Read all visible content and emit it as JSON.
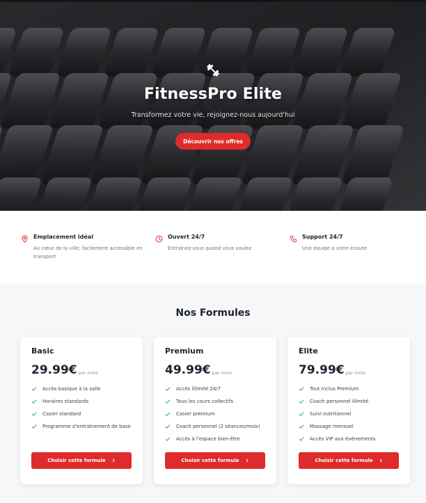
{
  "colors": {
    "accent": "#df2b2b",
    "check": "#3bb273",
    "bg": "#f6f7f9"
  },
  "hero": {
    "icon": "dumbbell-icon",
    "title": "FitnessPro Elite",
    "subtitle": "Transformez votre vie, rejoignez-nous aujourd'hui",
    "cta_label": "Découvrir nos offres"
  },
  "features": [
    {
      "icon": "location-pin-icon",
      "title": "Emplacement idéal",
      "desc": "Au cœur de la ville, facilement accessible en transport"
    },
    {
      "icon": "clock-icon",
      "title": "Ouvert 24/7",
      "desc": "Entraînez-vous quand vous voulez"
    },
    {
      "icon": "phone-icon",
      "title": "Support 24/7",
      "desc": "Une équipe à votre écoute"
    }
  ],
  "plans": {
    "title": "Nos Formules",
    "per_label": "par mois",
    "button_label": "Choisir cette formule",
    "items": [
      {
        "name": "Basic",
        "price": "29.99€",
        "features": [
          "Accès basique à la salle",
          "Horaires standards",
          "Casier standard",
          "Programme d'entraînement de base"
        ]
      },
      {
        "name": "Premium",
        "price": "49.99€",
        "features": [
          "Accès illimité 24/7",
          "Tous les cours collectifs",
          "Casier premium",
          "Coach personnel (2 séances/mois)",
          "Accès à l'espace bien-être"
        ]
      },
      {
        "name": "Elite",
        "price": "79.99€",
        "features": [
          "Tout inclus Premium",
          "Coach personnel illimité",
          "Suivi nutritionnel",
          "Massage mensuel",
          "Accès VIP aux événements"
        ]
      }
    ]
  }
}
